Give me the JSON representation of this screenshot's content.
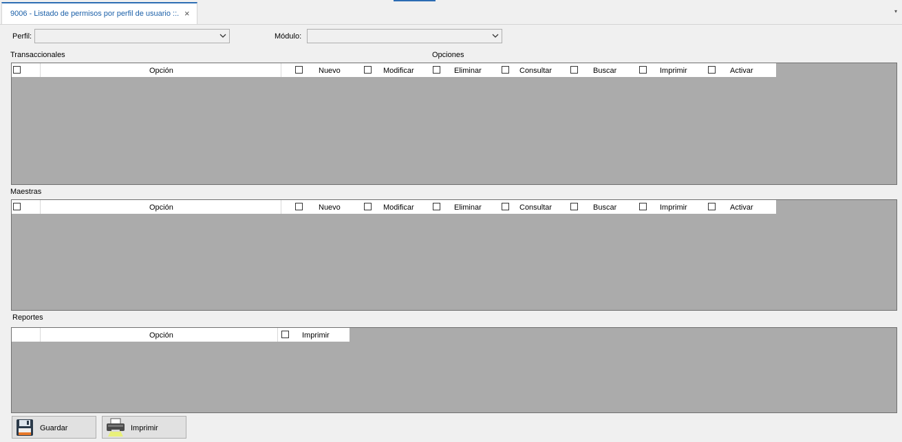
{
  "tab": {
    "title": "9006 - Listado de permisos por perfil de usuario ::.",
    "close": "×",
    "menu": "▾"
  },
  "filters": {
    "perfil_label": "Perfil:",
    "perfil_value": "",
    "modulo_label": "Módulo:",
    "modulo_value": ""
  },
  "sections": {
    "transaccionales": "Transaccionales",
    "opciones": "Opciones",
    "maestras": "Maestras",
    "reportes": "Reportes"
  },
  "grid_columns": {
    "opcion": "Opción",
    "nuevo": "Nuevo",
    "modificar": "Modificar",
    "eliminar": "Eliminar",
    "consultar": "Consultar",
    "buscar": "Buscar",
    "imprimir": "Imprimir",
    "activar": "Activar"
  },
  "buttons": {
    "guardar": "Guardar",
    "imprimir": "Imprimir"
  },
  "colors": {
    "accent": "#2b6cb3",
    "grid_background": "#ababab",
    "tab_text": "#1a5fa8"
  },
  "icons": {
    "save": "floppy-disk-icon",
    "print": "printer-icon",
    "dropdown": "chevron-down-icon"
  }
}
